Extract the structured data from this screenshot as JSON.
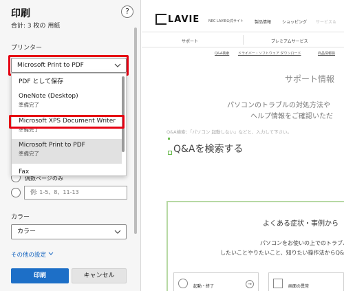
{
  "print_panel": {
    "title": "印刷",
    "subtitle": "合計: 3 枚の 用紙",
    "help": "?",
    "printer_label": "プリンター",
    "printer_selected": "Microsoft Print to PDF",
    "dropdown_options": [
      {
        "name": "PDF として保存",
        "status": ""
      },
      {
        "name": "OneNote (Desktop)",
        "status": "準備完了"
      },
      {
        "name": "Microsoft XPS Document Writer",
        "status": "準備完了"
      },
      {
        "name": "Microsoft Print to PDF",
        "status": "準備完了",
        "selected": true
      },
      {
        "name": "Fax",
        "status": ""
      }
    ],
    "range_partial": "偶数ページのみ",
    "range_placeholder": "例: 1-5、8、11-13",
    "color_label": "カラー",
    "color_selected": "カラー",
    "more_settings": "その他の設定",
    "print_button": "印刷",
    "cancel_button": "キャンセル",
    "highlight_color": "#e60012",
    "accent_color": "#1d6fc7"
  },
  "preview": {
    "logo": "LAVIE",
    "logo_sub": "NEC LAVIE公式サイト",
    "top_nav": [
      "製品情報",
      "ショッピング",
      "サービス＆"
    ],
    "nav2": [
      "サポート",
      "プレミアムサービス"
    ],
    "sub_links": [
      "Q&A検索",
      "ドライバー・ソフトウェア ダウンロード",
      "商品情報検"
    ],
    "hero_title": "サポート情報",
    "hero_line1": "パソコンのトラブルの対処方法や",
    "hero_line2": "ヘルプ情報をご確認いただ",
    "search_hint": "Q&A検索：「パソコン 起動しない」などと、入力して下さい。",
    "qa_title": "Q&Aを検索する",
    "green_title": "よくある症状・事例から",
    "green_line1": "パソコンをお使いの上でのトラブルな",
    "green_line2": "したいことやりたいこと、知りたい操作法からQ&A",
    "cards": [
      "起動・終了",
      "画面の異常"
    ],
    "green_color": "#b7d9a4"
  }
}
